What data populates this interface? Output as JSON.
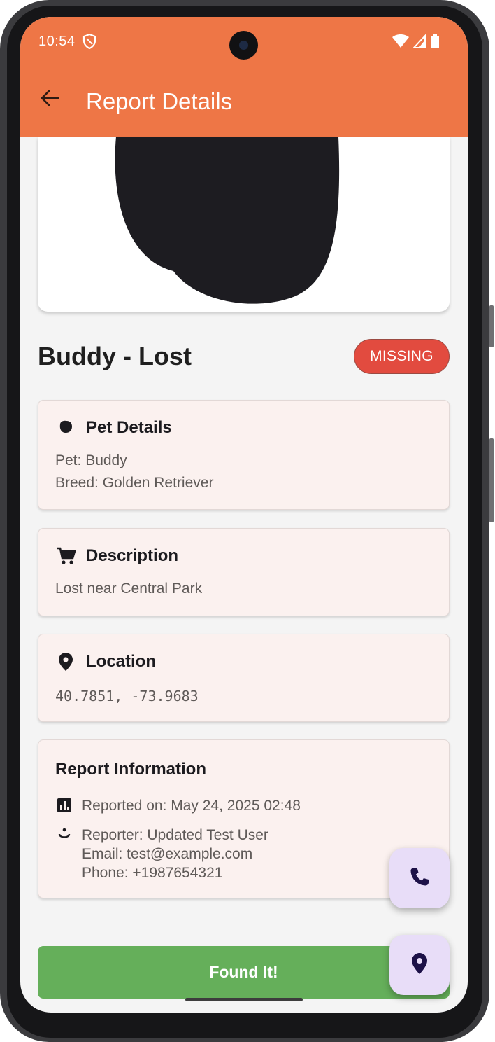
{
  "colors": {
    "app_bar": "#ee7646",
    "badge_missing": "#e24b3f",
    "found_button": "#65af5a",
    "fab_bg": "#e8ddf8",
    "fab_icon": "#1d1148",
    "card_bg": "#fbf1ef"
  },
  "status_bar": {
    "time": "10:54",
    "icons": [
      "shield-icon",
      "wifi-icon",
      "signal-icon",
      "battery-icon"
    ]
  },
  "app_bar": {
    "back_icon": "arrow-back-icon",
    "title": "Report Details"
  },
  "header": {
    "title": "Buddy - Lost",
    "status_badge": "MISSING"
  },
  "pet_details": {
    "icon": "pet-icon",
    "title": "Pet Details",
    "pet_line": "Pet: Buddy",
    "breed_line": "Breed: Golden Retriever"
  },
  "description": {
    "icon": "cart-icon",
    "title": "Description",
    "text": "Lost near Central Park"
  },
  "location": {
    "icon": "location-pin-icon",
    "title": "Location",
    "coords": "40.7851, -73.9683"
  },
  "report_info": {
    "title": "Report Information",
    "reported_on": "Reported on: May 24, 2025 02:48",
    "reporter": "Reporter: Updated Test User",
    "email": "Email: test@example.com",
    "phone": "Phone: +1987654321"
  },
  "actions": {
    "found_button": "Found It!",
    "call_fab_icon": "phone-icon",
    "map_fab_icon": "location-pin-icon"
  }
}
